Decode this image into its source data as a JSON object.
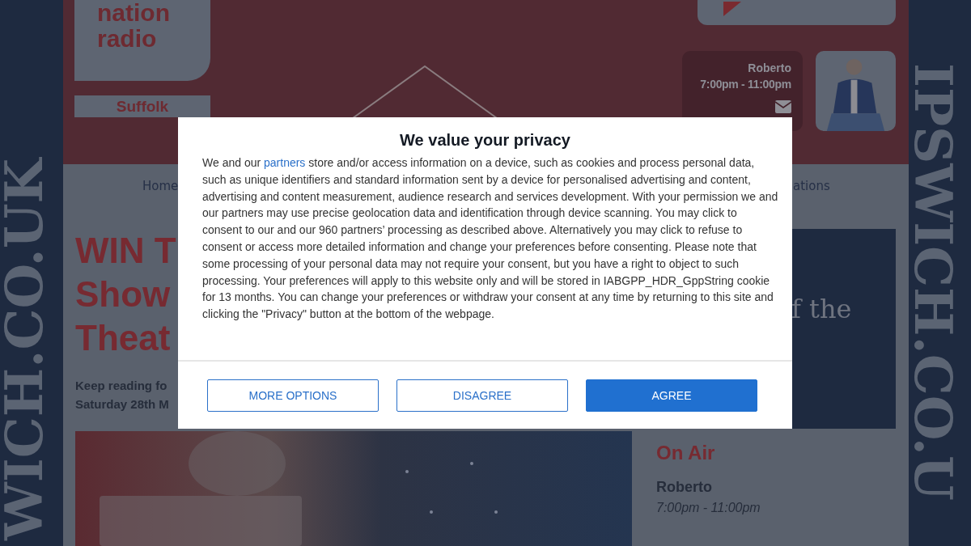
{
  "side_banners": {
    "left": "WICH.CO.UK",
    "right": "IPSWICH.CO.U"
  },
  "header": {
    "logo_text": "nation radio",
    "logo_region": "Suffolk",
    "presenter": {
      "name": "Roberto",
      "time": "7:00pm - 11:00pm"
    },
    "presenter_photo": {
      "kind": "picture"
    }
  },
  "nav": {
    "items": [
      "Home",
      "ations"
    ]
  },
  "article": {
    "headline": [
      "WIN T",
      "Show",
      "Theat"
    ],
    "intro": [
      "Keep reading fo",
      "Saturday 28th M"
    ],
    "image": {
      "kind": "picture"
    }
  },
  "ad_panel": {
    "text": "f the"
  },
  "on_air": {
    "heading": "On Air",
    "name": "Roberto",
    "time": "7:00pm - 11:00pm"
  },
  "consent_dialog": {
    "title": "We value your privacy",
    "body_before": "We and our ",
    "body_link": "partners",
    "body_after": " store and/or access information on a device, such as cookies and process personal data, such as unique identifiers and standard information sent by a device for personalised advertising and content, advertising and content measurement, audience research and services development. With your permission we and our partners may use precise geolocation data and identification through device scanning. You may click to consent to our and our 960 partners’ processing as described above. Alternatively you may click to refuse to consent or access more detailed information and change your preferences before consenting. Please note that some processing of your personal data may not require your consent, but you have a right to object to such processing. Your preferences will apply to this website only and will be stored in IABGPP_HDR_GppString cookie for 13 months. You can change your preferences or withdraw your consent at any time by returning to this site and clicking the \"Privacy\" button at the bottom of the webpage.",
    "buttons": [
      {
        "label": "MORE OPTIONS",
        "kind": "outline"
      },
      {
        "label": "DISAGREE",
        "kind": "outline"
      },
      {
        "label": "AGREE",
        "kind": "primary"
      }
    ]
  }
}
